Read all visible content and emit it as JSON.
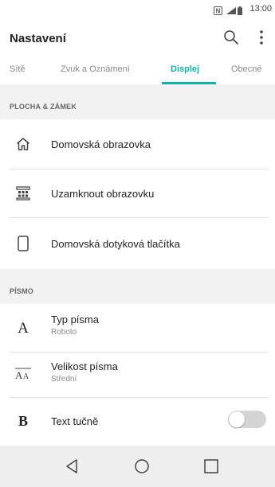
{
  "status_bar": {
    "time": "13:00",
    "icons": [
      "nfc-icon",
      "signal-icon",
      "battery-icon"
    ]
  },
  "app_bar": {
    "title": "Nastavení",
    "search_icon": "search-icon",
    "overflow_icon": "more-vertical-icon"
  },
  "tabs": {
    "items": [
      {
        "label": "Sítě"
      },
      {
        "label": "Zvuk a Oznámení"
      },
      {
        "label": "Displej"
      },
      {
        "label": "Obecné"
      }
    ],
    "active_index": 2,
    "accent_color": "#12b3a7"
  },
  "sections": [
    {
      "header": "PLOCHA & ZÁMEK",
      "items": [
        {
          "icon": "home-icon",
          "label": "Domovská obrazovka"
        },
        {
          "icon": "lock-screen-icon",
          "label": "Uzamknout obrazovku"
        },
        {
          "icon": "phone-buttons-icon",
          "label": "Domovská dotyková tlačítka"
        }
      ]
    },
    {
      "header": "PÍSMO",
      "items": [
        {
          "icon": "font-type-icon",
          "glyph": "A",
          "label": "Typ písma",
          "value": "Roboto"
        },
        {
          "icon": "font-size-icon",
          "label": "Velikost písma",
          "value": "Střední"
        },
        {
          "icon": "bold-text-icon",
          "glyph": "B",
          "label": "Text tučně",
          "toggle": false
        }
      ]
    }
  ],
  "nav_bar": {
    "buttons": [
      "back-icon",
      "home-circle-icon",
      "recents-icon"
    ]
  }
}
